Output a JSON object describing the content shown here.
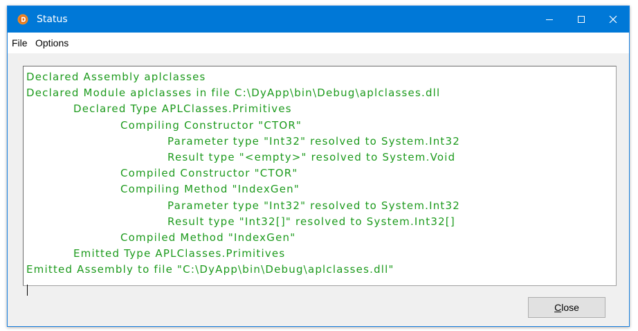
{
  "window": {
    "title": "Status",
    "icon": "dyalog-app-icon"
  },
  "caption_buttons": {
    "minimize": "minimize-icon",
    "maximize": "maximize-icon",
    "close": "close-icon"
  },
  "menu": {
    "items": [
      {
        "label": "File"
      },
      {
        "label": "Options"
      }
    ]
  },
  "log": {
    "color": "#1c9a1c",
    "lines": [
      {
        "indent": 0,
        "text": "Declared Assembly aplclasses"
      },
      {
        "indent": 0,
        "text": "Declared Module aplclasses in file C:\\DyApp\\bin\\Debug\\aplclasses.dll"
      },
      {
        "indent": 1,
        "text": "Declared Type APLClasses.Primitives"
      },
      {
        "indent": 2,
        "text": "Compiling Constructor \"CTOR\""
      },
      {
        "indent": 3,
        "text": "Parameter type \"Int32\" resolved to System.Int32"
      },
      {
        "indent": 3,
        "text": "Result type \"<empty>\" resolved to System.Void"
      },
      {
        "indent": 2,
        "text": "Compiled Constructor \"CTOR\""
      },
      {
        "indent": 2,
        "text": "Compiling Method \"IndexGen\""
      },
      {
        "indent": 3,
        "text": "Parameter type \"Int32\" resolved to System.Int32"
      },
      {
        "indent": 3,
        "text": "Result type \"Int32[]\" resolved to System.Int32[]"
      },
      {
        "indent": 2,
        "text": "Compiled Method \"IndexGen\""
      },
      {
        "indent": 1,
        "text": "Emitted Type APLClasses.Primitives"
      },
      {
        "indent": 0,
        "text": "Emitted Assembly to file \"C:\\DyApp\\bin\\Debug\\aplclasses.dll\""
      }
    ]
  },
  "buttons": {
    "close_label": "Close",
    "close_accel": "C",
    "close_rest": "lose"
  },
  "colors": {
    "titlebar": "#0078d7",
    "window_bg": "#f0f0f0",
    "log_text": "#1c9a1c"
  }
}
